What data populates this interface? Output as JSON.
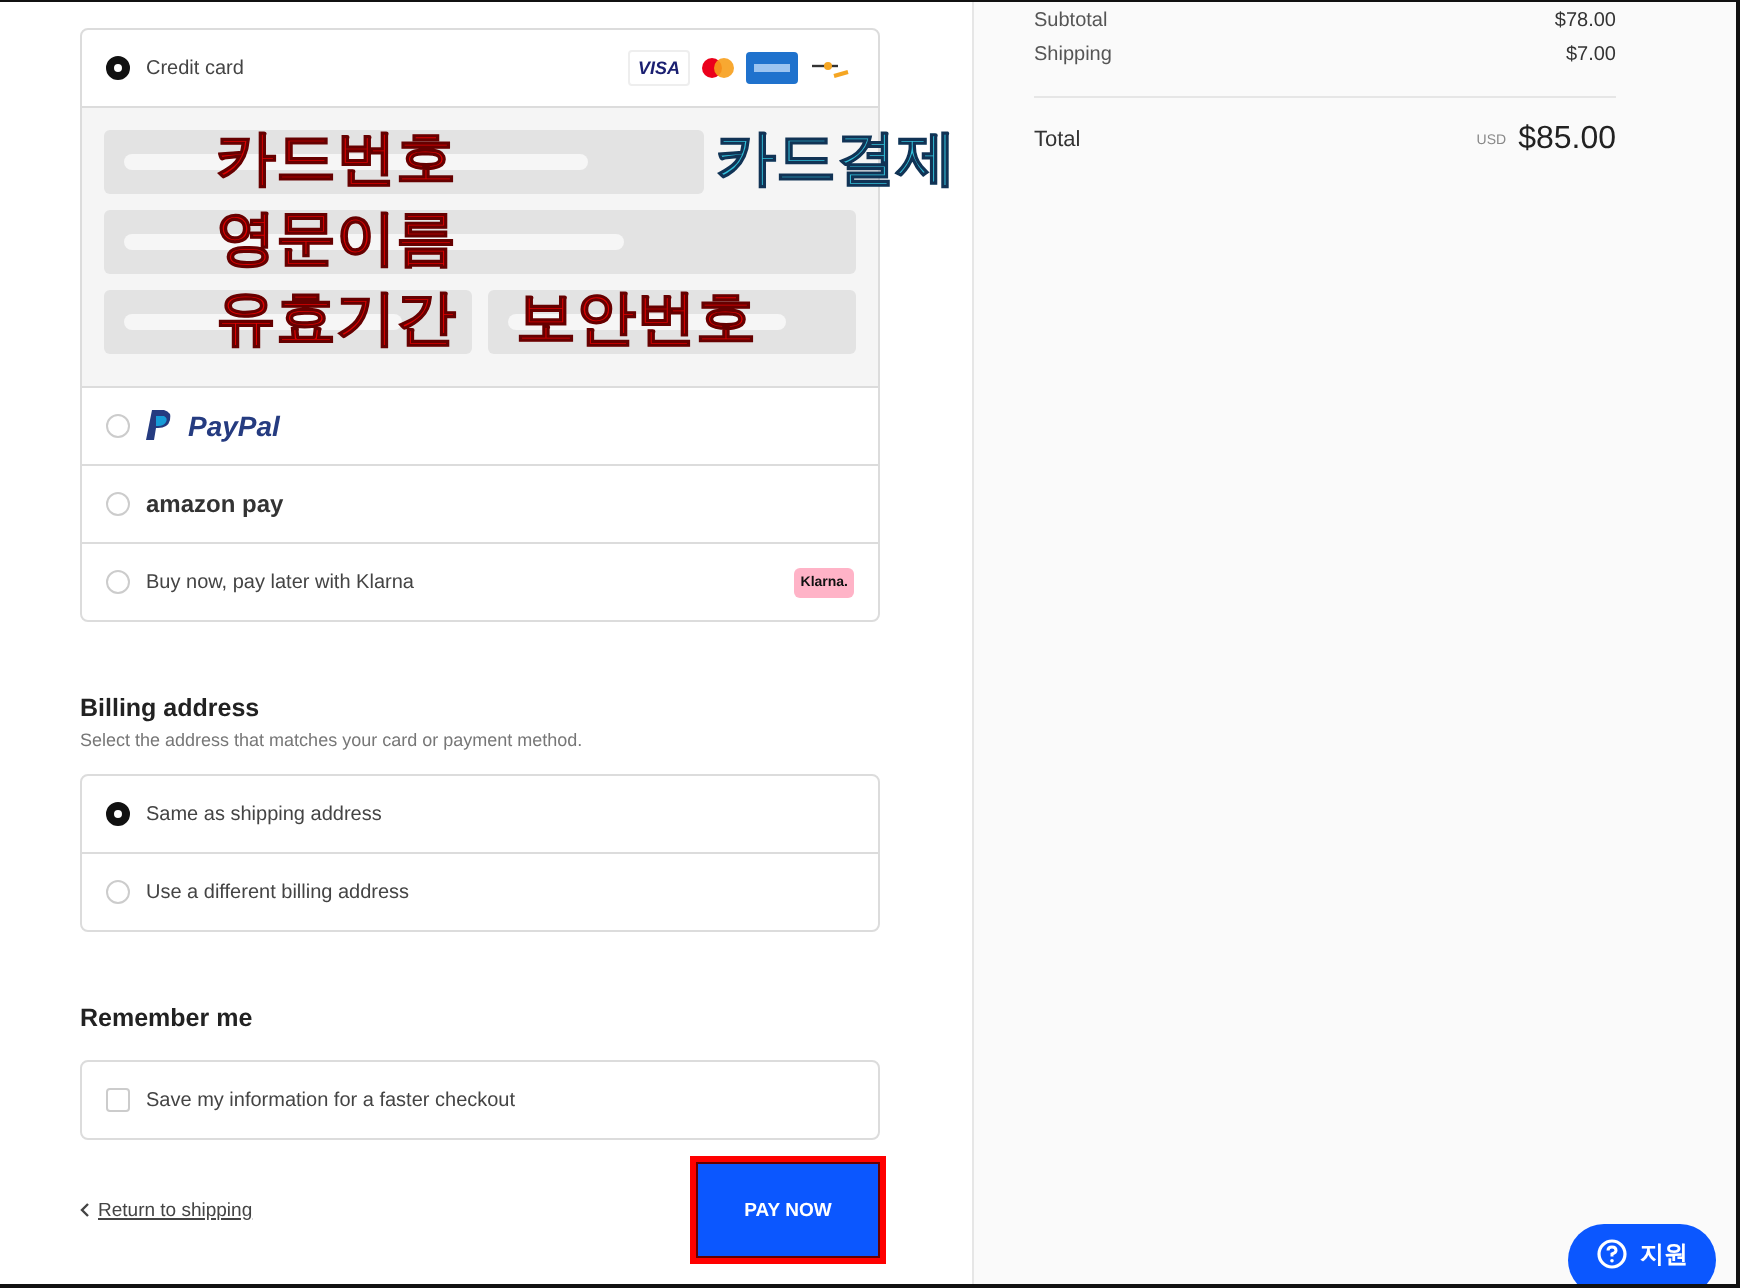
{
  "payment_methods": [
    {
      "kind": "card",
      "label": "Credit card",
      "selected": true,
      "brands": [
        "VISA"
      ]
    },
    {
      "kind": "paypal",
      "label": "PayPal",
      "selected": false
    },
    {
      "kind": "amazon",
      "label": "amazon pay",
      "selected": false
    },
    {
      "kind": "klarna",
      "label": "Buy now, pay later with Klarna",
      "selected": false,
      "badge": "Klarna."
    }
  ],
  "card_form": {
    "caption": "카드결제",
    "rows": [
      [
        {
          "annotation": "카드번호"
        }
      ],
      [
        {
          "annotation": "영문이름"
        }
      ],
      [
        {
          "annotation": "유효기간"
        },
        {
          "annotation": "보안번호"
        }
      ]
    ]
  },
  "billing": {
    "title": "Billing address",
    "subtitle": "Select the address that matches your card or payment method.",
    "options": [
      {
        "label": "Same as shipping address",
        "selected": true
      },
      {
        "label": "Use a different billing address",
        "selected": false
      }
    ]
  },
  "remember": {
    "title": "Remember me",
    "label": "Save my information for a faster checkout",
    "checked": false
  },
  "return_link": "Return to shipping",
  "pay_button": {
    "label": "PAY NOW",
    "highlighted": true
  },
  "summary": {
    "lines": [
      {
        "label": "Subtotal",
        "value": "$78.00"
      },
      {
        "label": "Shipping",
        "value": "$7.00"
      }
    ],
    "total_label": "Total",
    "currency": "USD",
    "total": "$85.00"
  },
  "support_button": {
    "label": "지원"
  }
}
